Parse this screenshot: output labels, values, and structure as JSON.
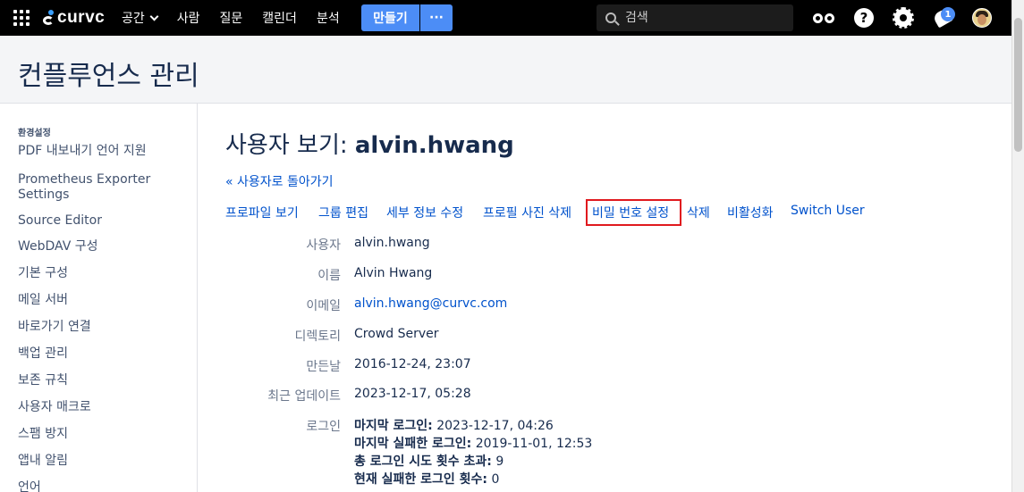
{
  "nav": {
    "brand": "curvc",
    "links": [
      "공간",
      "사람",
      "질문",
      "캘린더",
      "분석"
    ],
    "create_label": "만들기",
    "more_label": "···",
    "search_placeholder": "검색",
    "help_glyph": "?",
    "notifications_count": "1"
  },
  "page": {
    "title": "컨플루언스 관리"
  },
  "sidebar": {
    "heading": "환경설정",
    "items": [
      "PDF 내보내기 언어 지원",
      "Prometheus Exporter Settings",
      "Source Editor",
      "WebDAV 구성",
      "기본 구성",
      "메일 서버",
      "바로가기 연결",
      "백업 관리",
      "보존 규칙",
      "사용자 매크로",
      "스팸 방지",
      "앱내 알림",
      "언어"
    ]
  },
  "main": {
    "heading_prefix": "사용자 보기: ",
    "heading_user": "alvin.hwang",
    "back_link": "« 사용자로 돌아가기",
    "actions": [
      "프로파일 보기",
      "그룹 편집",
      "세부 정보 수정",
      "프로필 사진 삭제",
      "비밀 번호 설정",
      "삭제",
      "비활성화",
      "Switch User"
    ],
    "details": [
      {
        "label": "사용자",
        "value": "alvin.hwang"
      },
      {
        "label": "이름",
        "value": "Alvin Hwang"
      },
      {
        "label": "이메일",
        "value": "alvin.hwang@curvc.com"
      },
      {
        "label": "디렉토리",
        "value": "Crowd Server"
      },
      {
        "label": "만든날",
        "value": "2016-12-24, 23:07"
      },
      {
        "label": "최근 업데이트",
        "value": "2023-12-17, 05:28"
      }
    ],
    "login": {
      "label": "로그인",
      "lines": [
        {
          "key": "마지막 로그인:",
          "value": " 2023-12-17, 04:26"
        },
        {
          "key": "마지막 실패한 로그인:",
          "value": " 2019-11-01, 12:53"
        },
        {
          "key": "총 로그인 시도 횟수 초과:",
          "value": " 9"
        },
        {
          "key": "현재 실패한 로그인 횟수:",
          "value": " 0"
        }
      ]
    }
  }
}
